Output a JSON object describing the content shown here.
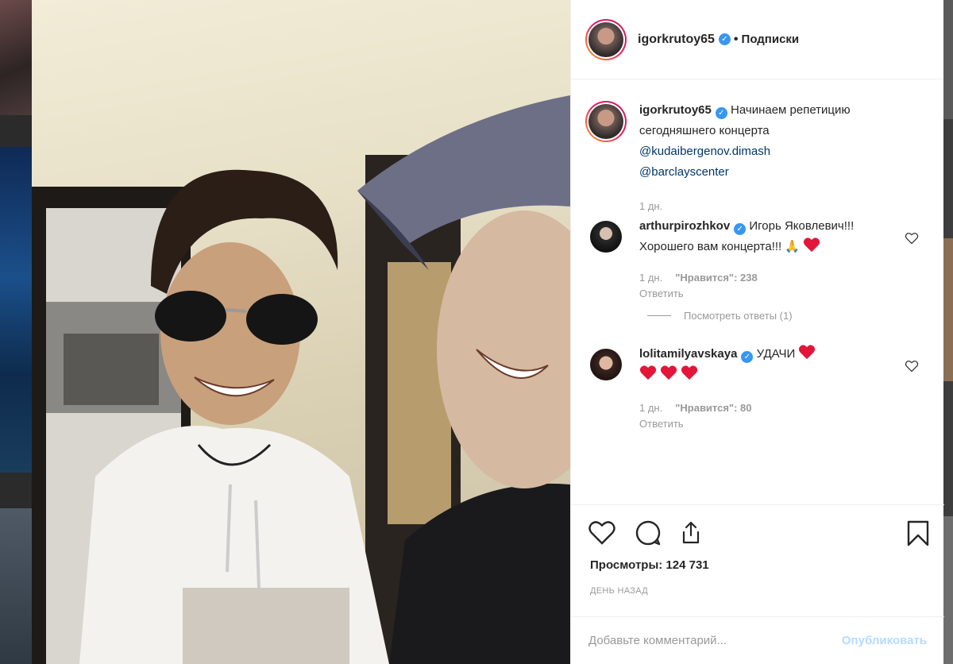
{
  "post": {
    "author": "igorkrutoy65",
    "follow_status": "Подписки",
    "caption_prefix": "Начинаем репетицию сегодняшнего концерта",
    "caption_mention_1": "@kudaibergenov.dimash",
    "caption_mention_2": "@barclayscenter",
    "caption_time": "1 дн."
  },
  "comments": [
    {
      "user": "arthurpirozhkov",
      "text": "Игорь Яковлевич!!! Хорошего вам концерта!!! 🙏❤️",
      "text_main": "Игорь Яковлевич!!! Хорошего вам концерта!!!",
      "emoji": "🙏",
      "time": "1 дн.",
      "likes": "\"Нравится\": 238",
      "reply": "Ответить",
      "view_replies": "Посмотреть ответы (1)"
    },
    {
      "user": "lolitamilyavskaya",
      "text": "УДАЧИ",
      "time": "1 дн.",
      "likes": "\"Нравится\": 80",
      "reply": "Ответить"
    }
  ],
  "stats": {
    "views": "Просмотры: 124 731",
    "posted": "ДЕНЬ НАЗАД"
  },
  "comment_box": {
    "placeholder": "Добавьте комментарий...",
    "publish": "Опубликовать"
  },
  "icons": {
    "like": "heart-icon",
    "comment": "comment-bubble-icon",
    "share": "share-icon",
    "save": "bookmark-icon",
    "verified": "verified-badge-icon"
  },
  "colors": {
    "link": "#003569",
    "verified": "#3897f0",
    "publish_disabled": "#b3dbff",
    "meta": "#999999",
    "heart_red": "#e3163a"
  }
}
